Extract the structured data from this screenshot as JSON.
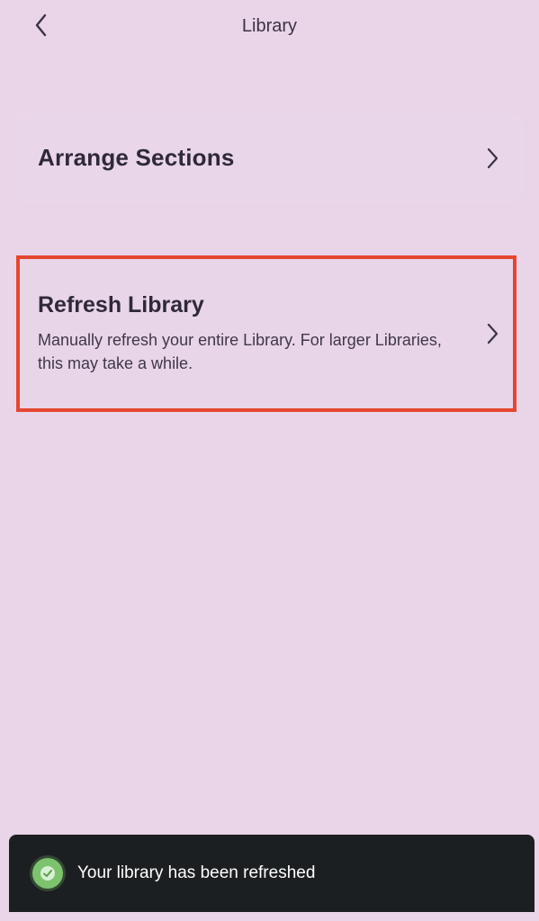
{
  "header": {
    "title": "Library",
    "back_icon": "chevron-left-icon"
  },
  "settings": {
    "arrange": {
      "label": "Arrange Sections",
      "icon": "chevron-right-icon"
    },
    "refresh": {
      "title": "Refresh Library",
      "description": "Manually refresh your entire Library. For larger Libraries, this may take a while.",
      "icon": "chevron-right-icon",
      "highlight_color": "#e64630"
    }
  },
  "toast": {
    "message": "Your library has been refreshed",
    "icon": "check-circle-icon",
    "icon_color": "#7dc36e"
  },
  "colors": {
    "background": "#e9d4e8",
    "toast_background": "#1c1f21"
  }
}
